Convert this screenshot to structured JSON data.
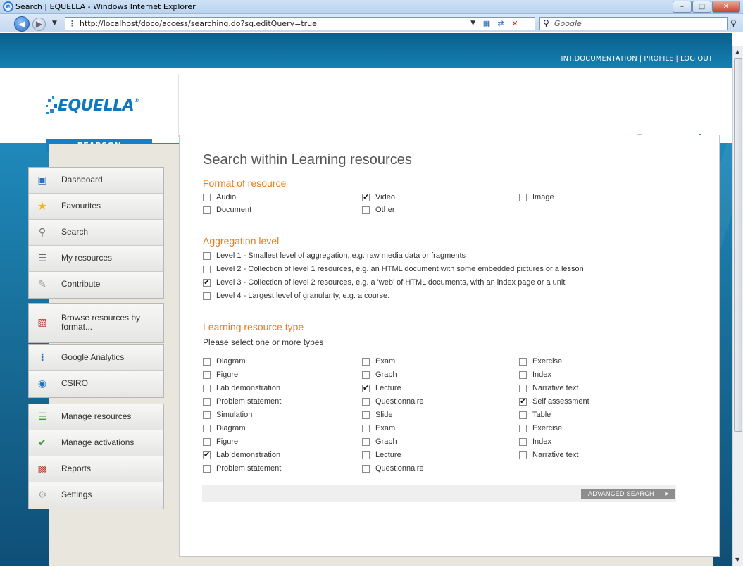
{
  "window": {
    "title": "Search | EQUELLA - Windows Internet Explorer",
    "url": "http://localhost/doco/access/searching.do?sq.editQuery=true",
    "search_placeholder": "Google"
  },
  "top_links": [
    "INT.DOCUMENTATION",
    "PROFILE",
    "LOG OUT"
  ],
  "logo": {
    "brand": "EQUELLA",
    "sub": "PEARSON"
  },
  "page_title": "Search",
  "sidebar": {
    "groups": [
      [
        {
          "label": "Dashboard",
          "icon": "dashboard-icon"
        },
        {
          "label": "Favourites",
          "icon": "star-icon"
        },
        {
          "label": "Search",
          "icon": "magnifier-icon"
        },
        {
          "label": "My resources",
          "icon": "database-icon"
        },
        {
          "label": "Contribute",
          "icon": "pencil-icon"
        }
      ],
      [
        {
          "label": "Browse resources by format...",
          "icon": "books-icon"
        }
      ],
      [
        {
          "label": "Google Analytics",
          "icon": "analytics-icon"
        },
        {
          "label": "CSIRO",
          "icon": "csiro-icon"
        }
      ],
      [
        {
          "label": "Manage resources",
          "icon": "manage-resources-icon"
        },
        {
          "label": "Manage activations",
          "icon": "manage-activations-icon"
        },
        {
          "label": "Reports",
          "icon": "reports-icon"
        },
        {
          "label": "Settings",
          "icon": "settings-gear-icon"
        }
      ]
    ]
  },
  "main": {
    "heading": "Search within Learning resources",
    "format": {
      "title": "Format of resource",
      "options": [
        {
          "label": "Audio",
          "checked": false
        },
        {
          "label": "Video",
          "checked": true
        },
        {
          "label": "Image",
          "checked": false
        },
        {
          "label": "Document",
          "checked": false
        },
        {
          "label": "Other",
          "checked": false
        }
      ]
    },
    "aggregation": {
      "title": "Aggregation level",
      "options": [
        {
          "label": "Level 1 - Smallest level of aggregation, e.g. raw media data or fragments",
          "checked": false
        },
        {
          "label": "Level 2 - Collection of level 1 resources, e.g. an HTML document with some embedded pictures or a lesson",
          "checked": false
        },
        {
          "label": "Level 3 - Collection of level 2 resources, e.g. a 'web' of HTML documents, with an index page or a unit",
          "checked": true
        },
        {
          "label": "Level 4 - Largest level of granularity, e.g. a course.",
          "checked": false
        }
      ]
    },
    "lrt": {
      "title": "Learning resource type",
      "subtitle": "Please select one or more types",
      "columns": [
        [
          {
            "label": "Diagram",
            "checked": false
          },
          {
            "label": "Figure",
            "checked": false
          },
          {
            "label": "Lab demonstration",
            "checked": false
          },
          {
            "label": "Problem statement",
            "checked": false
          },
          {
            "label": "Simulation",
            "checked": false
          },
          {
            "label": "Diagram",
            "checked": false
          },
          {
            "label": "Figure",
            "checked": false
          },
          {
            "label": "Lab demonstration",
            "checked": true
          },
          {
            "label": "Problem statement",
            "checked": false
          }
        ],
        [
          {
            "label": "Exam",
            "checked": false
          },
          {
            "label": "Graph",
            "checked": false
          },
          {
            "label": "Lecture",
            "checked": true
          },
          {
            "label": "Questionnaire",
            "checked": false
          },
          {
            "label": "Slide",
            "checked": false
          },
          {
            "label": "Exam",
            "checked": false
          },
          {
            "label": "Graph",
            "checked": false
          },
          {
            "label": "Lecture",
            "checked": false
          },
          {
            "label": "Questionnaire",
            "checked": false
          }
        ],
        [
          {
            "label": "Exercise",
            "checked": false
          },
          {
            "label": "Index",
            "checked": false
          },
          {
            "label": "Narrative text",
            "checked": false
          },
          {
            "label": "Self assessment",
            "checked": true
          },
          {
            "label": "Table",
            "checked": false
          },
          {
            "label": "Exercise",
            "checked": false
          },
          {
            "label": "Index",
            "checked": false
          },
          {
            "label": "Narrative text",
            "checked": false
          }
        ]
      ]
    },
    "advanced_button": "ADVANCED SEARCH"
  }
}
